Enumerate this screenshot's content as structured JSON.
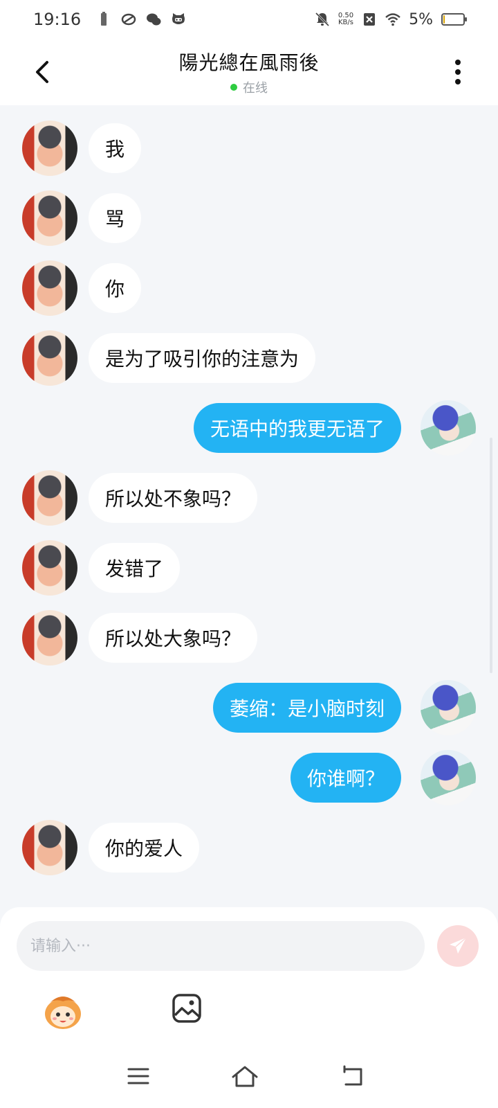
{
  "status_bar": {
    "time": "19:16",
    "net_speed_value": "0.50",
    "net_speed_unit": "KB/s",
    "battery_percent": "5%",
    "battery_level": 0.05,
    "icons": [
      "battery-saver-icon",
      "sync-icon",
      "wechat-icon",
      "cat-icon",
      "mute-icon",
      "sim-icon",
      "wifi-icon",
      "battery-icon"
    ]
  },
  "header": {
    "title": "陽光總在風雨後",
    "presence": "在线",
    "back_icon": "chevron-left-icon",
    "more_icon": "more-vertical-icon"
  },
  "messages": [
    {
      "side": "left",
      "text": "我"
    },
    {
      "side": "left",
      "text": "骂"
    },
    {
      "side": "left",
      "text": "你"
    },
    {
      "side": "left",
      "text": "是为了吸引你的注意为"
    },
    {
      "side": "right",
      "text": "无语中的我更无语了"
    },
    {
      "side": "left",
      "text": "所以处不象吗？"
    },
    {
      "side": "left",
      "text": "发错了"
    },
    {
      "side": "left",
      "text": "所以处大象吗？"
    },
    {
      "side": "right",
      "text": "萎缩：是小脑时刻"
    },
    {
      "side": "right",
      "text": "你谁啊？"
    },
    {
      "side": "left",
      "text": "你的爱人"
    }
  ],
  "composer": {
    "placeholder": "请输入···",
    "value": "",
    "send_icon": "send-icon",
    "emoji_icon": "emoji-mascot-icon",
    "image_icon": "image-icon"
  },
  "colors": {
    "accent": "#23b3f3",
    "background": "#f4f6f9",
    "online": "#2ecc40",
    "send_disabled": "#fbdada"
  }
}
